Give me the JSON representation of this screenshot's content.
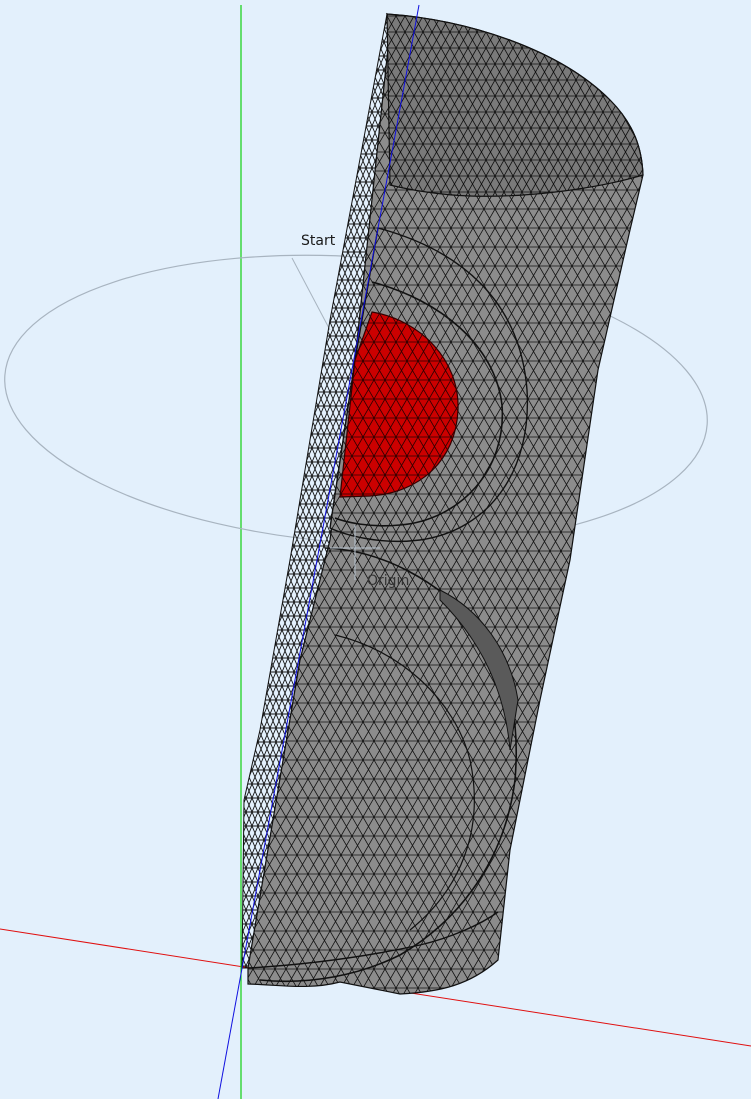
{
  "viewport": {
    "background": "#e3f0fc",
    "mesh_color": "#8c8c8c",
    "mesh_line_color": "#111111",
    "highlight_color": "#cc0000"
  },
  "labels": {
    "start": "Start",
    "origin": "Origin"
  },
  "axes": {
    "x_color": "#e01010",
    "y_color": "#10d010",
    "z_color": "#1010e0"
  }
}
